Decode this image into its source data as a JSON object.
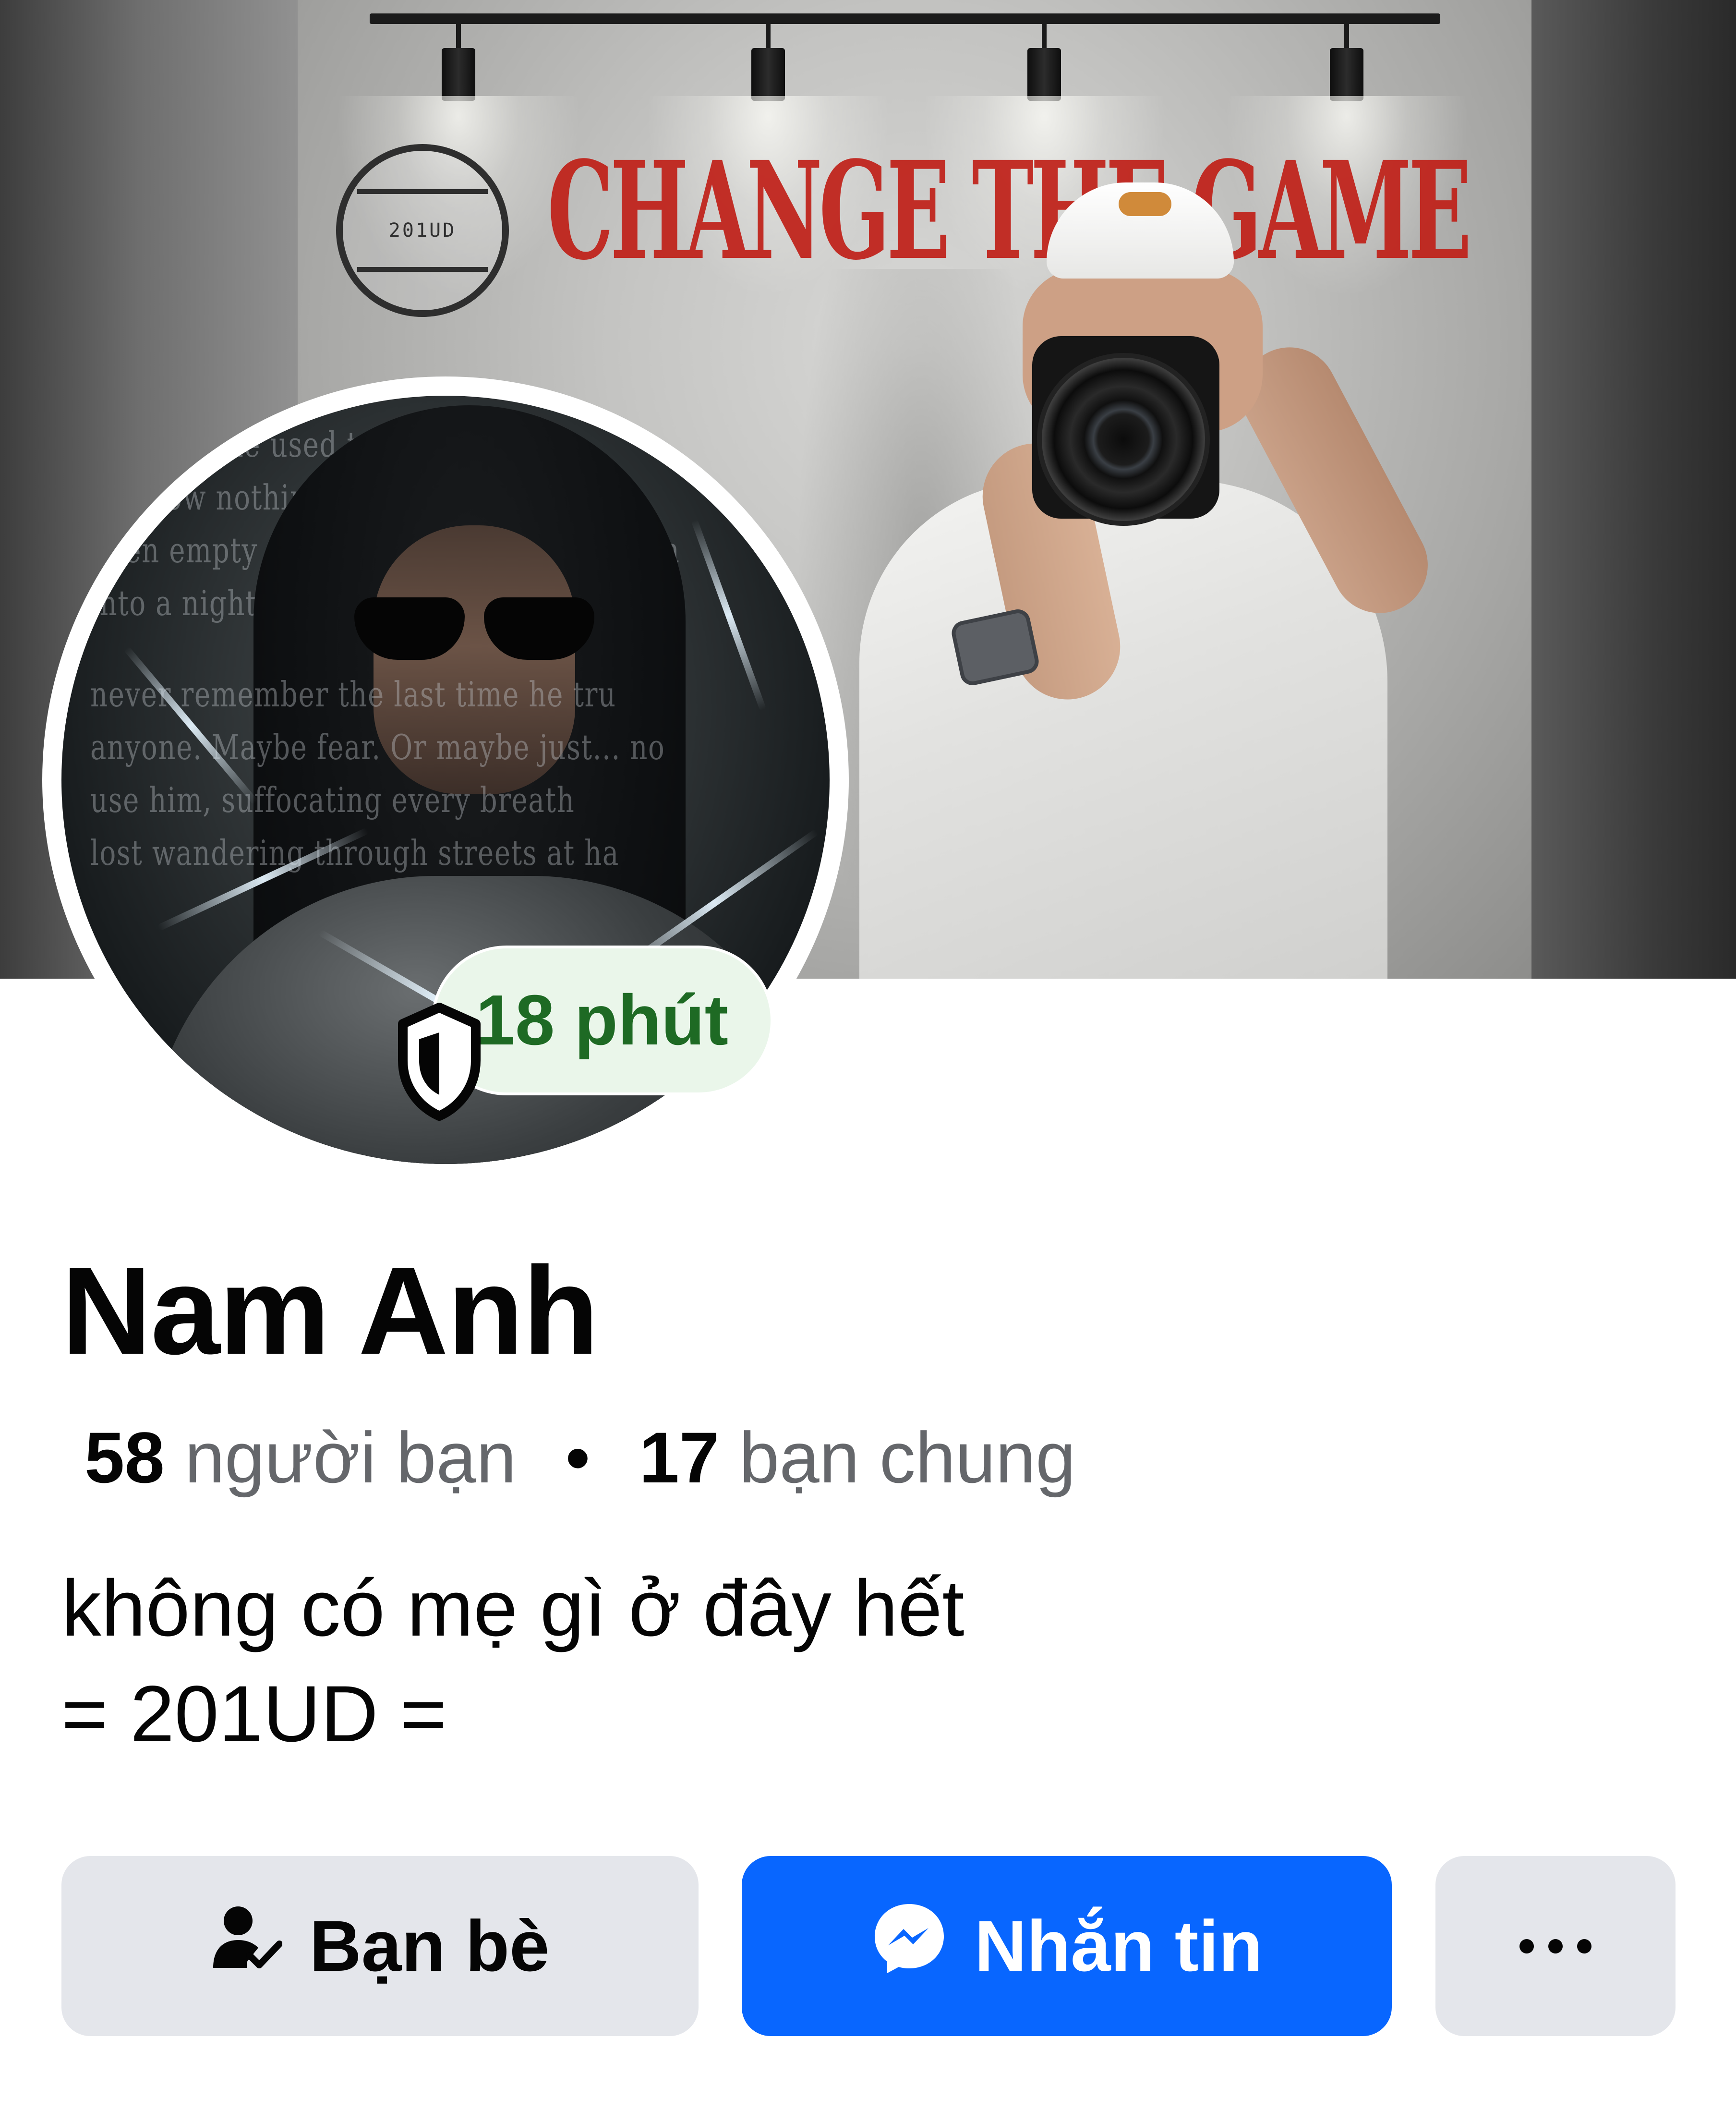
{
  "cover": {
    "wall_logo_text": "201UD",
    "wall_slogan": "CHANGE THE GAME"
  },
  "avatar": {
    "text_lines": [
      "someone he used to be. o",
      "see now nothing more than faded",
      "been empty memories flashing images in",
      "into a night with no escape",
      "never remember the last time he tru",
      "anyone. Maybe fear. Or maybe just... no",
      "use him, suffocating every breath",
      "lost wandering through streets at ha"
    ]
  },
  "status": {
    "active_label": "18 phút",
    "color": "#1e6a24",
    "background": "#eaf6ea"
  },
  "profile": {
    "name": "Nam Anh",
    "friends_count": "58",
    "friends_label": "người bạn",
    "separator": "•",
    "mutual_count": "17",
    "mutual_label": "bạn chung",
    "bio_line_1": "không có mẹ gì ở đây hết",
    "bio_line_2": "= 201UD ="
  },
  "actions": {
    "friends_label": "Bạn bè",
    "friends_icon": "person-check-icon",
    "message_label": "Nhắn tin",
    "message_icon": "messenger-icon",
    "more_icon": "more-horizontal-icon"
  },
  "colors": {
    "primary_blue": "#0866ff",
    "secondary_button": "#e4e6eb",
    "text_primary": "#050505",
    "text_secondary": "#65676b"
  }
}
